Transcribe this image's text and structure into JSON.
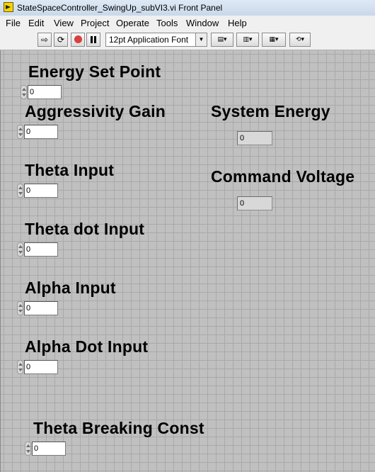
{
  "window": {
    "title": "StateSpaceController_SwingUp_subVI3.vi Front Panel"
  },
  "menu": {
    "items": [
      "File",
      "Edit",
      "View",
      "Project",
      "Operate",
      "Tools",
      "Window",
      "Help"
    ]
  },
  "toolbar": {
    "font_selector": "12pt Application Font"
  },
  "controls": [
    {
      "label": "Energy Set Point",
      "value": "0"
    },
    {
      "label": "Aggressivity Gain",
      "value": "0"
    },
    {
      "label": "Theta Input",
      "value": "0"
    },
    {
      "label": "Theta dot Input",
      "value": "0"
    },
    {
      "label": "Alpha Input",
      "value": "0"
    },
    {
      "label": "Alpha Dot Input",
      "value": "0"
    },
    {
      "label": "Theta Breaking Const",
      "value": "0"
    }
  ],
  "indicators": [
    {
      "label": "System Energy",
      "value": "0"
    },
    {
      "label": "Command Voltage",
      "value": "0"
    }
  ],
  "colors": {
    "panel_background": "#c0c0c0",
    "grid_line": "#a9a9a9",
    "control_field": "#ffffff",
    "indicator_field": "#d8d8d8"
  }
}
